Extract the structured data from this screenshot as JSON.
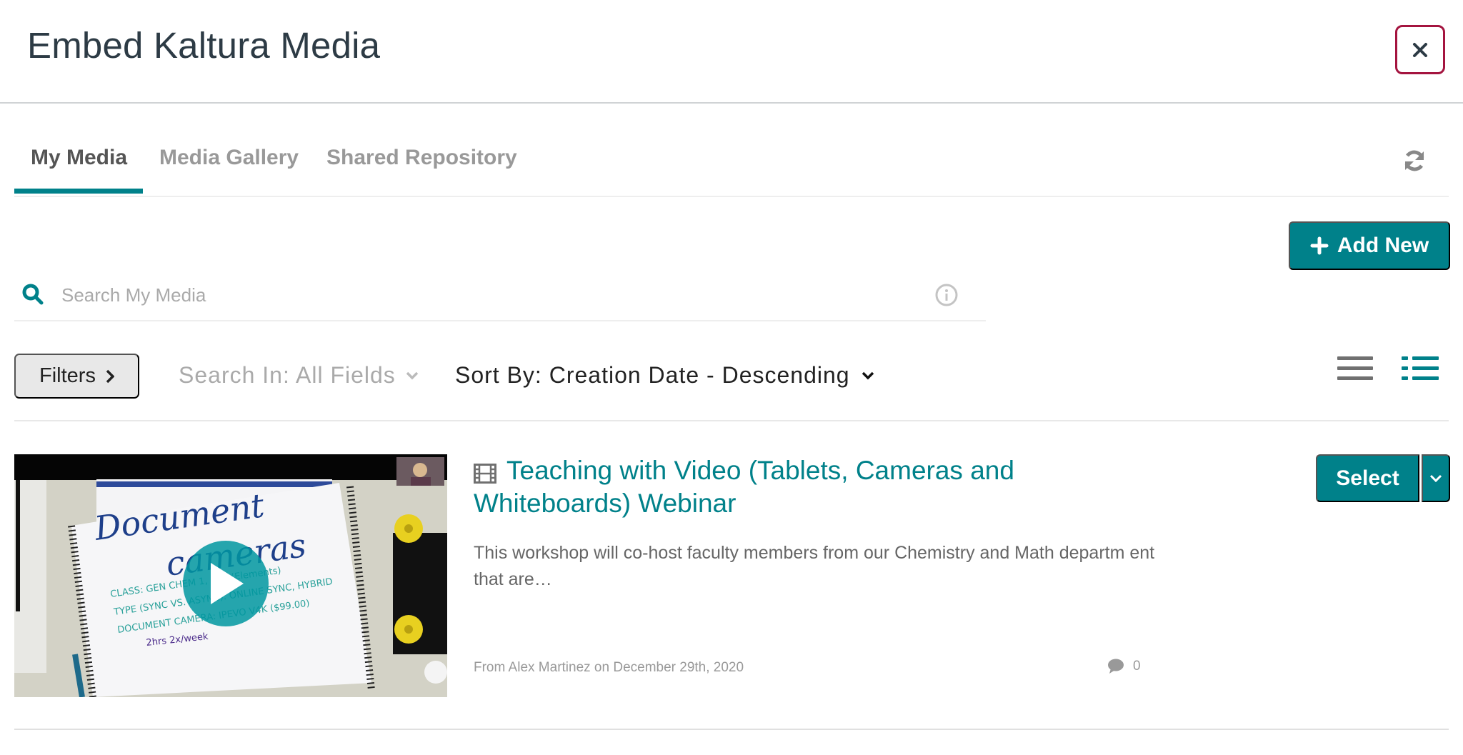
{
  "header": {
    "title": "Embed Kaltura Media",
    "close_icon": "close-icon"
  },
  "tabs": [
    {
      "label": "My Media",
      "active": true
    },
    {
      "label": "Media Gallery",
      "active": false
    },
    {
      "label": "Shared Repository",
      "active": false
    }
  ],
  "toolbar": {
    "refresh_icon": "refresh-icon",
    "add_new_label": "Add New",
    "add_new_icon": "plus-icon"
  },
  "search": {
    "placeholder": "Search My Media",
    "value": "",
    "search_icon": "search-icon",
    "info_icon": "info-icon"
  },
  "filters": {
    "filters_label": "Filters",
    "search_in_label": "Search In: All Fields",
    "sort_by_label": "Sort By: Creation Date - Descending",
    "view_modes": [
      {
        "name": "compact-list",
        "icon": "list-icon",
        "active": false
      },
      {
        "name": "detailed-list",
        "icon": "detailed-list-icon",
        "active": true
      }
    ]
  },
  "entries": [
    {
      "type_icon": "film-icon",
      "title": "Teaching with Video (Tablets, Cameras and Whiteboards) Webinar",
      "description": "This workshop will co-host faculty members from our Chemistry and Math departm ent that are…",
      "meta": "From Alex Martinez on December 29th, 2020",
      "comment_count": "0",
      "select_label": "Select",
      "thumbnail_alt": "Document cameras notebook video thumbnail"
    }
  ],
  "colors": {
    "accent": "#00818a",
    "close_border": "#a4143f",
    "title_text": "#2d3b45",
    "muted_text": "#999999"
  }
}
